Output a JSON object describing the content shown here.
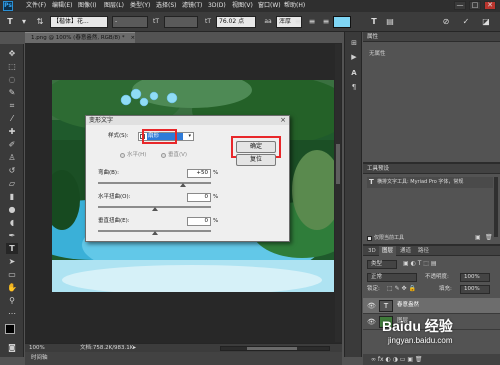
{
  "menubar": {
    "logo": "Ps",
    "items": [
      "文件(F)",
      "编辑(E)",
      "图像(I)",
      "图层(L)",
      "类型(Y)",
      "选择(S)",
      "滤镜(T)",
      "3D(D)",
      "视图(V)",
      "窗口(W)",
      "帮助(H)"
    ],
    "window_buttons": [
      "—",
      "□",
      "✕"
    ]
  },
  "optbar": {
    "font_family": "【楷体】花...",
    "font_style": "-",
    "font_size": "76.02 点",
    "antialias": "浑厚",
    "text_color": "#7fd6f5"
  },
  "document": {
    "tab_label": "1.png @ 100% (春意盎然, RGB/8) *",
    "tab_close": "×",
    "zoom": "100%",
    "doc_info": "文档:758.2K/983.1K",
    "timeline_label": "时间轴"
  },
  "dialog": {
    "title": "变形文字",
    "close": "×",
    "style_label": "样式(S):",
    "style_value": "扇形",
    "horizontal": "水平(H)",
    "vertical": "垂直(V)",
    "bend_label": "弯曲(B):",
    "bend_value": "+50",
    "bend_pct": 0.75,
    "hdist_label": "水平扭曲(O):",
    "hdist_value": "0",
    "hdist_pct": 0.5,
    "vdist_label": "垂直扭曲(E):",
    "vdist_value": "0",
    "vdist_pct": 0.5,
    "percent": "%",
    "ok": "确定",
    "cancel": "复位"
  },
  "props": {
    "title": "属性",
    "empty": "无属性"
  },
  "toolpresets": {
    "title": "工具预设",
    "item": "横排文字工具: Myriad Pro 字体，常规",
    "current_only": "仅限当前工具"
  },
  "layers": {
    "tabs": [
      "3D",
      "图层",
      "通道",
      "路径"
    ],
    "kind": "类型",
    "blend": "正常",
    "opacity_label": "不透明度:",
    "opacity": "100%",
    "lock_label": "锁定:",
    "fill_label": "填充:",
    "fill": "100%",
    "items": [
      {
        "name": "春意盎然",
        "thumb": "T"
      },
      {
        "name": "图层",
        "thumb": ""
      }
    ]
  },
  "watermark": {
    "brand": "Baidu 经验",
    "url": "jingyan.baidu.com"
  }
}
